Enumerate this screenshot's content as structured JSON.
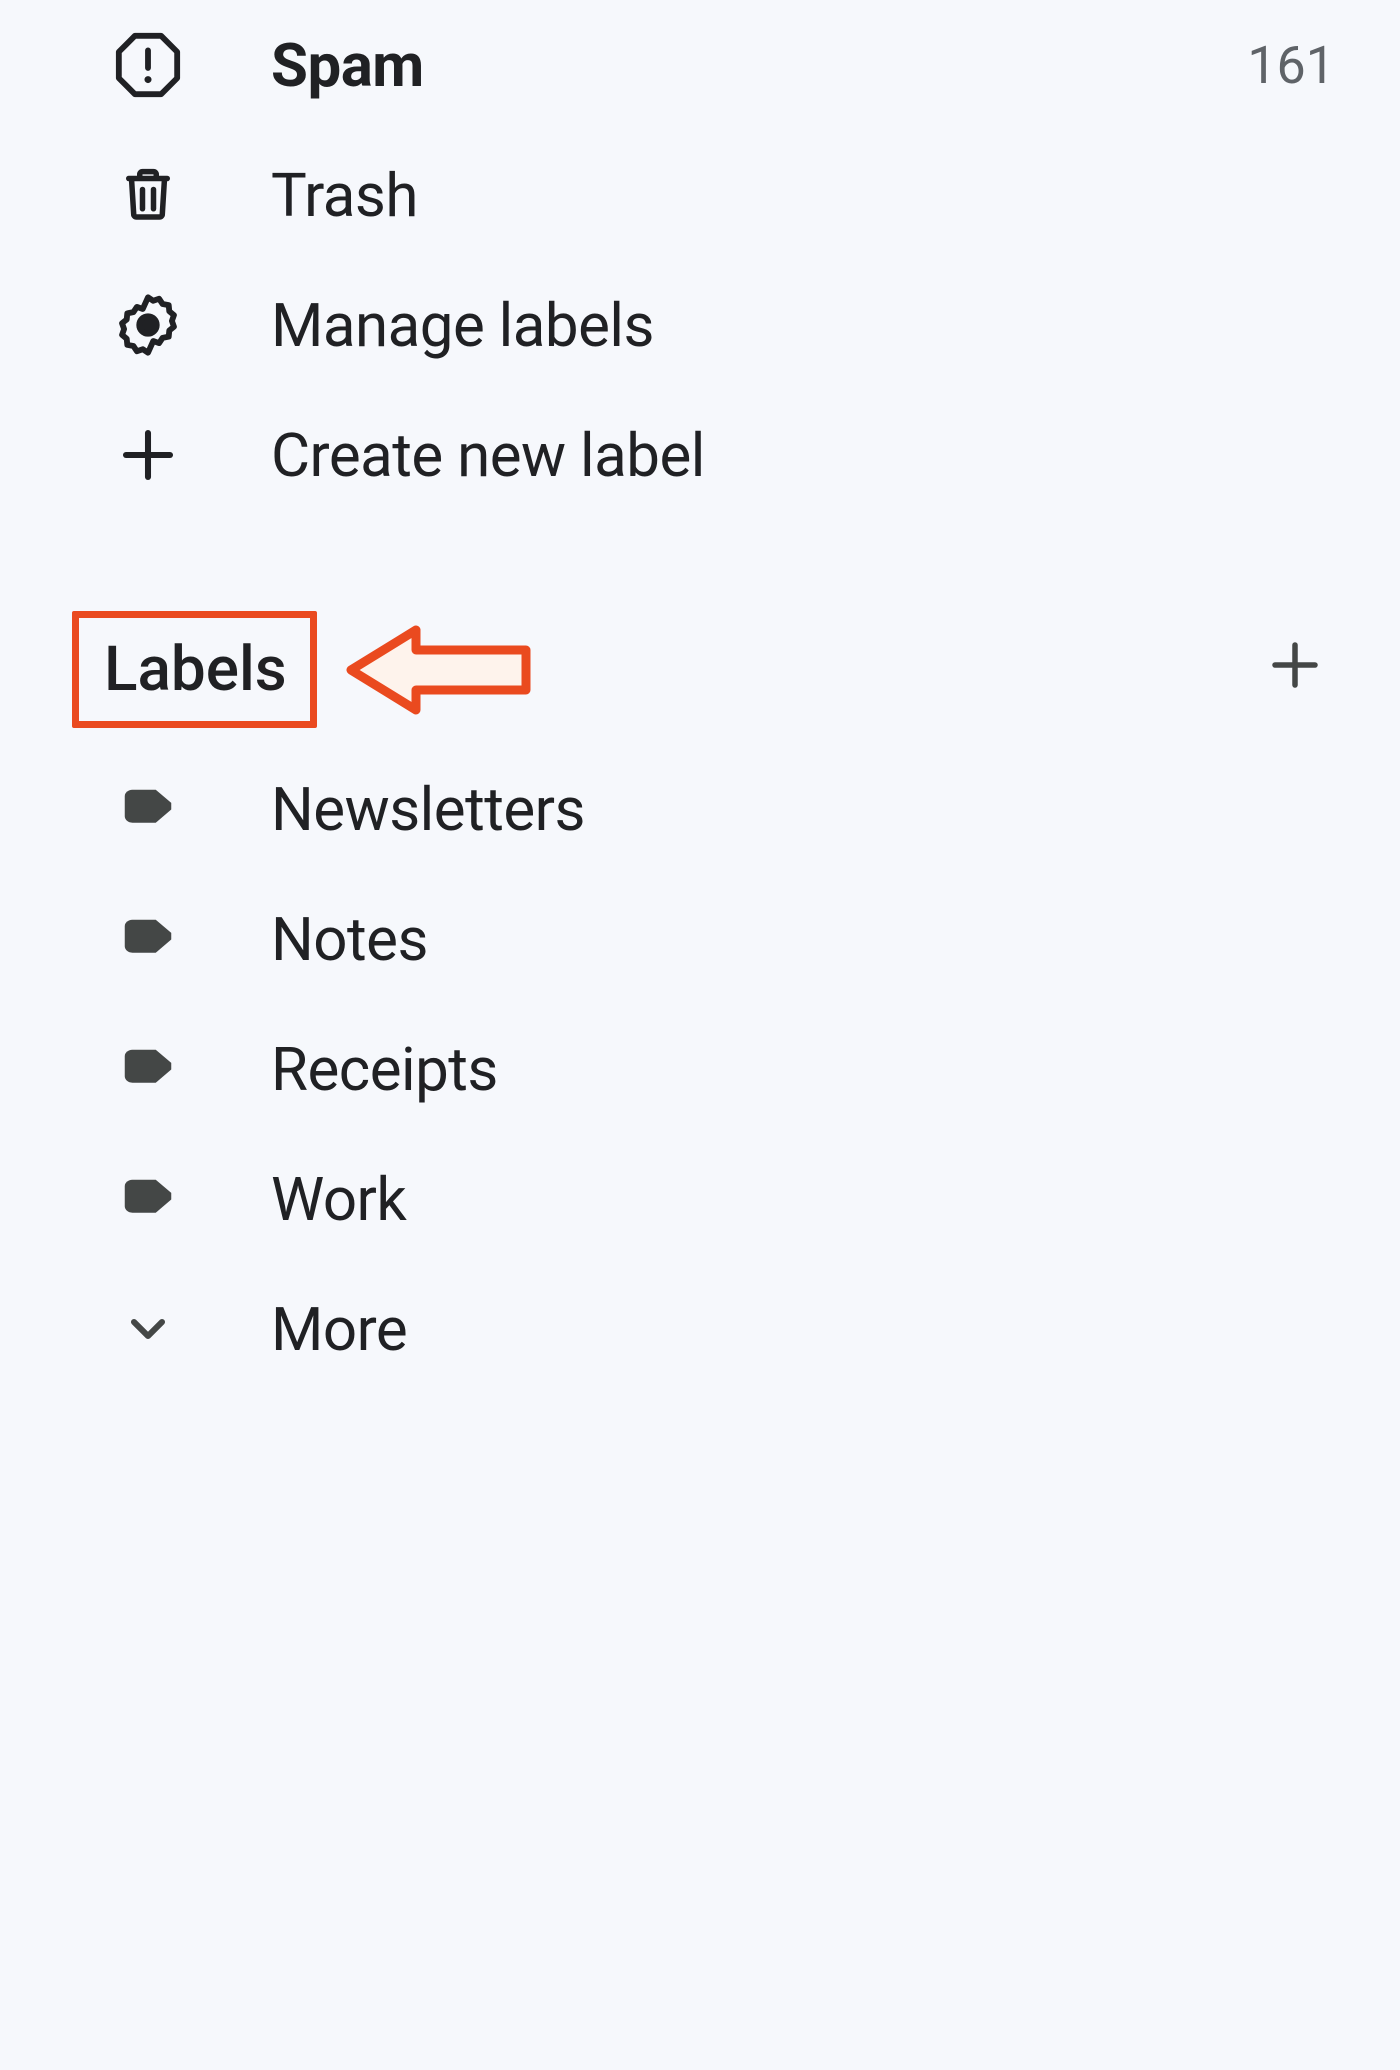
{
  "sidebar": {
    "system_items": [
      {
        "icon": "spam",
        "label": "Spam",
        "count": "161",
        "bold": true
      },
      {
        "icon": "trash",
        "label": "Trash"
      },
      {
        "icon": "gear",
        "label": "Manage labels"
      },
      {
        "icon": "plus",
        "label": "Create new label"
      }
    ],
    "labels_section": {
      "title": "Labels",
      "items": [
        {
          "label": "Newsletters"
        },
        {
          "label": "Notes"
        },
        {
          "label": "Receipts"
        },
        {
          "label": "Work"
        }
      ],
      "more_label": "More"
    }
  }
}
